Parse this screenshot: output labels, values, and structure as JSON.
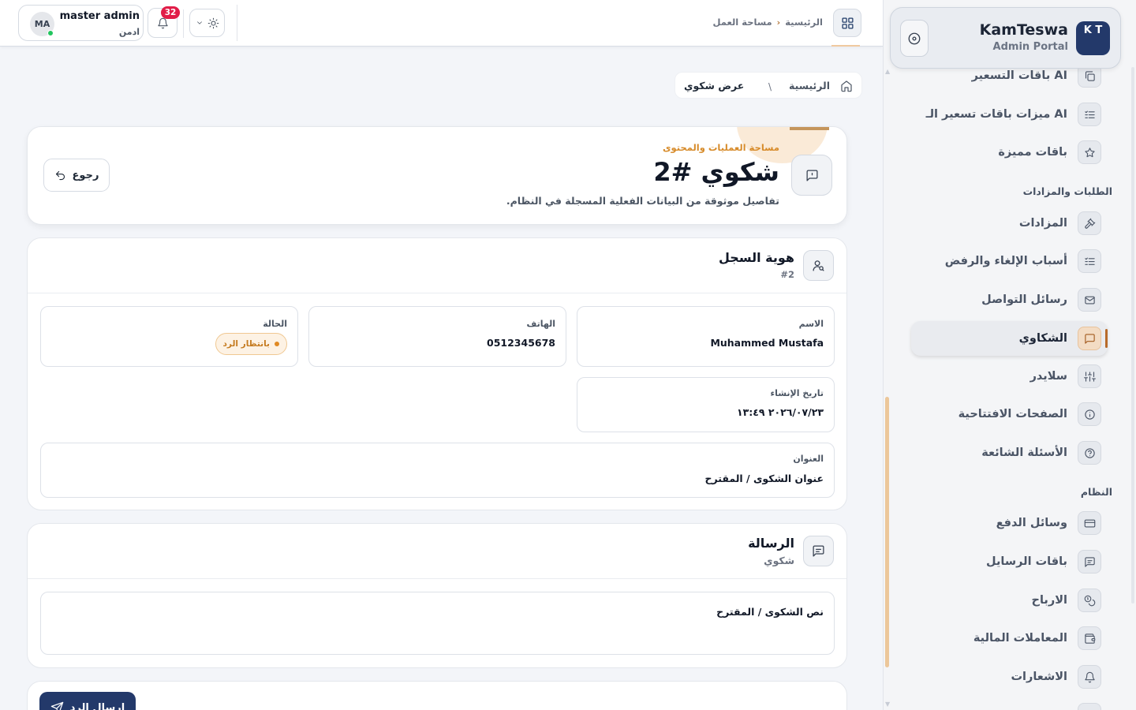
{
  "brand": {
    "logo_text": "K T",
    "name": "KamTeswa",
    "subtitle": "Admin Portal"
  },
  "sidebar": {
    "items_top": [
      {
        "label": "باقات التسعير AI",
        "icon": "copy-icon"
      },
      {
        "label": "ميزات باقات تسعير الـ AI",
        "icon": "list-check-icon"
      },
      {
        "label": "باقات مميزة",
        "icon": "star-icon"
      }
    ],
    "section_orders": "الطلبات والمزادات",
    "items_orders": [
      {
        "label": "المزادات",
        "icon": "gavel-icon"
      },
      {
        "label": "أسباب الإلغاء والرفض",
        "icon": "list-check-icon"
      },
      {
        "label": "رسائل التواصل",
        "icon": "mail-icon"
      },
      {
        "label": "الشكاوي",
        "icon": "message-square-icon",
        "active": true
      },
      {
        "label": "سلايدر",
        "icon": "sliders-icon"
      },
      {
        "label": "الصفحات الافتتاحية",
        "icon": "info-icon"
      },
      {
        "label": "الأسئلة الشائعة",
        "icon": "help-circle-icon"
      }
    ],
    "section_system": "النظام",
    "items_system": [
      {
        "label": "وسائل الدفع",
        "icon": "credit-card-icon"
      },
      {
        "label": "باقات الرسايل",
        "icon": "message-icon"
      },
      {
        "label": "الارباح",
        "icon": "coins-icon"
      },
      {
        "label": "المعاملات المالية",
        "icon": "wallet-icon"
      },
      {
        "label": "الاشعارات",
        "icon": "bell-icon"
      }
    ],
    "accent": "#b76a2a"
  },
  "topbar": {
    "breadcrumb_home": "الرئيسية",
    "breadcrumb_current": "مساحة العمل",
    "notifications_count": "32",
    "user": {
      "initials": "MA",
      "name": "master admin",
      "role": "ادمن"
    }
  },
  "page_breadcrumb": {
    "home": "الرئيسية",
    "separator": "\\",
    "current": "عرض شكوي"
  },
  "header": {
    "kicker": "مساحة العمليات والمحتوى",
    "title": "شكوي #2",
    "subtitle": "تفاصيل موثوقة من البيانات الفعلية المسجلة في النظام.",
    "back_label": "رجوع"
  },
  "record": {
    "title": "هوية السجل",
    "id": "#2",
    "fields": {
      "name_label": "الاسم",
      "name_value": "Muhammed Mustafa",
      "phone_label": "الهاتف",
      "phone_value": "0512345678",
      "status_label": "الحالة",
      "status_value": "بانتظار الرد",
      "created_label": "تاريخ الإنشاء",
      "created_value": "٢٠٢٦/٠٧/٢٣ ١٣:٤٩",
      "subject_label": "العنوان",
      "subject_value": "عنوان الشكوى / المقترح"
    }
  },
  "message": {
    "title": "الرسالة",
    "subtitle": "شكوي",
    "body": "نص الشكوى / المقترح"
  },
  "reply": {
    "send_label": "إرسال الرد"
  },
  "colors": {
    "primary": "#23396a",
    "warning": "#d78b2a",
    "danger": "#e11d48",
    "online": "#22c55e"
  }
}
